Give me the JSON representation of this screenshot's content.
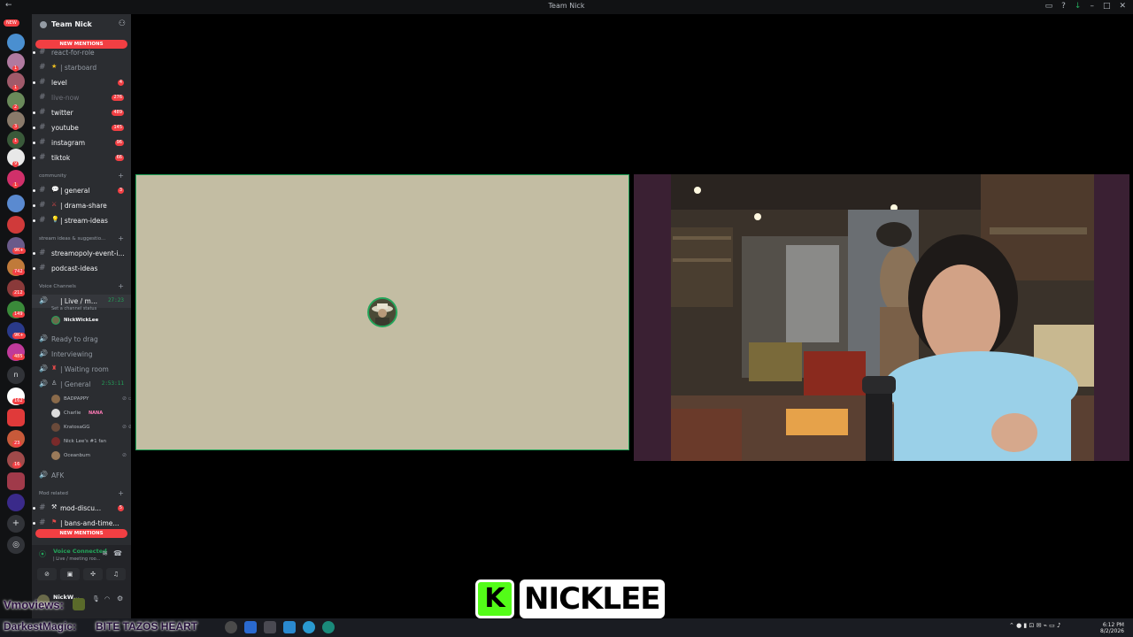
{
  "window": {
    "title": "Team Nick"
  },
  "server_rail": {
    "new_label": "NEW",
    "badges": [
      "1",
      "1",
      "2",
      "3",
      "1",
      "9",
      "1",
      "9K+",
      "742",
      "212",
      "149",
      "9K+",
      "485",
      "162",
      "23",
      "16"
    ],
    "text_icon": "n"
  },
  "server": {
    "name": "Team Nick"
  },
  "pills": {
    "top": "NEW MENTIONS",
    "bottom": "NEW MENTIONS"
  },
  "channels": {
    "partial_top": "react-for-role",
    "starboard": "| starboard",
    "level": {
      "label": "level",
      "badge": "4"
    },
    "live_now": {
      "label": "live-now",
      "badge": "276"
    },
    "twitter": {
      "label": "twitter",
      "badge": "489"
    },
    "youtube": {
      "label": "youtube",
      "badge": "145"
    },
    "instagram": {
      "label": "instagram",
      "badge": "96"
    },
    "tiktok": {
      "label": "tiktok",
      "badge": "66"
    }
  },
  "community": {
    "header": "community",
    "general": {
      "label": "| general",
      "badge": "3"
    },
    "drama_share": "| drama-share",
    "stream_ideas": "| stream-ideas"
  },
  "stream_ideas_cat": {
    "header": "stream ideas & suggestio...",
    "streamopoly": "streamopoly-event-i...",
    "podcast": "podcast-ideas"
  },
  "voice": {
    "header": "Voice Channels",
    "live_meeting": {
      "label": "| Live / m...",
      "time": "27:23",
      "status": "Set a channel status"
    },
    "live_user": "NickWickLee",
    "ready_to_drag": "Ready to drag",
    "interviewing": "Interviewing",
    "waiting_room": "| Waiting room",
    "general": {
      "label": "| General",
      "time": "2:53:11"
    },
    "general_users": [
      {
        "name": "BADPAPPY"
      },
      {
        "name": "Charlie",
        "tag": "NANA"
      },
      {
        "name": "KratosaGG"
      },
      {
        "name": "Nick Lee's #1 fan"
      },
      {
        "name": "Oceanbum"
      }
    ],
    "afk": "AFK"
  },
  "mod": {
    "header": "Mod related",
    "mod_discu": {
      "label": "mod-discu...",
      "badge": "5"
    },
    "bans": "| bans-and-time..."
  },
  "voice_panel": {
    "title": "Voice Connected",
    "subtitle": "| Live / meeting roo..."
  },
  "user_panel": {
    "name": "NickW..."
  },
  "overlay": {
    "viewers": "Vmoviews:",
    "ticker_user": "DarkestMagic:",
    "ticker_msg": "BITE TAZOS HEART",
    "brand_letter": "K",
    "brand_name": "NICKLEE"
  },
  "tray": {
    "time": "6:12 PM",
    "date": "8/2/2026"
  },
  "colors": {
    "accent_green": "#23a55a",
    "mention_red": "#f23f43",
    "kick_green": "#53fc18",
    "sidebar": "#2b2d31"
  }
}
